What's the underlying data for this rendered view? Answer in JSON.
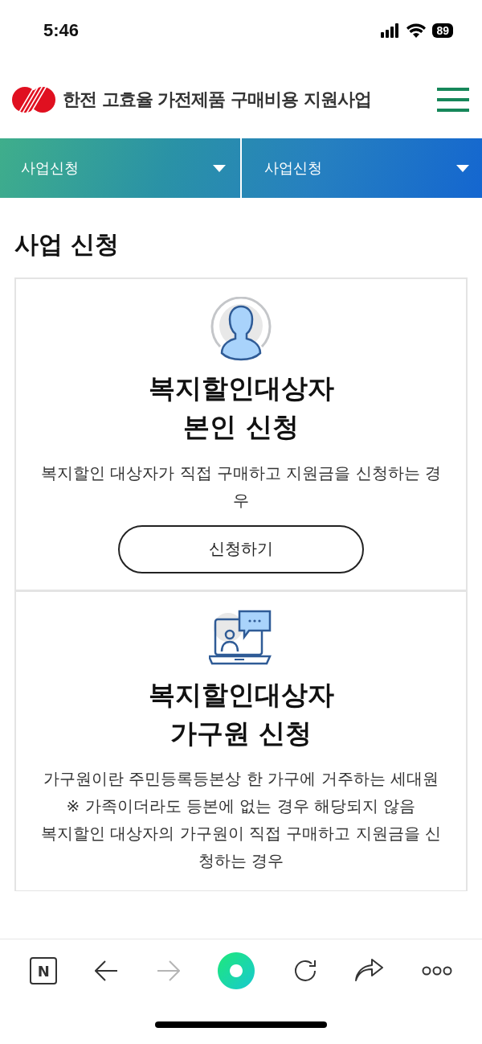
{
  "status_bar": {
    "time": "5:46",
    "battery": "89"
  },
  "header": {
    "title": "한전 고효율 가전제품 구매비용 지원사업"
  },
  "nav": [
    {
      "label": "사업신청"
    },
    {
      "label": "사업신청"
    }
  ],
  "page_title": "사업 신청",
  "cards": [
    {
      "kind": "person",
      "title": [
        "복지할인대상자",
        "본인 신청"
      ],
      "description": [
        "복지할인 대상자가 직접 구매하고 지원금을 신청하는 경우"
      ],
      "button": "신청하기"
    },
    {
      "kind": "laptop",
      "title": [
        "복지할인대상자",
        "가구원 신청"
      ],
      "description": [
        "가구원이란 주민등록등본상 한 가구에 거주하는 세대원",
        "※ 가족이더라도 등본에 없는 경우 해당되지 않음",
        "복지할인 대상자의 가구원이 직접 구매하고 지원금을 신청하는 경우"
      ]
    }
  ],
  "toolbar": [
    {
      "kind": "home",
      "label": "N",
      "disabled": false
    },
    {
      "kind": "back",
      "disabled": false
    },
    {
      "kind": "forward",
      "disabled": true
    },
    {
      "kind": "green",
      "disabled": false
    },
    {
      "kind": "reload",
      "disabled": false
    },
    {
      "kind": "share",
      "disabled": false
    },
    {
      "kind": "more",
      "disabled": false
    }
  ]
}
